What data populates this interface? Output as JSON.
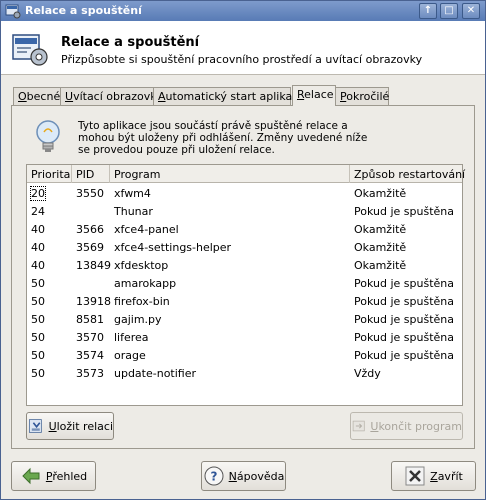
{
  "window": {
    "title": "Relace a spouštění"
  },
  "header": {
    "title": "Relace a spouštění",
    "subtitle": "Přizpůsobte si spouštění pracovního prostředí a uvítací obrazovky"
  },
  "tabs": [
    {
      "label": "Obecné",
      "accel": "O",
      "rest": "becné"
    },
    {
      "label": "Uvítací obrazovka",
      "accel": "U",
      "rest": "vítací obrazovka"
    },
    {
      "label": "Automatický start aplikace",
      "accel": "A",
      "rest": "utomatický start aplikace"
    },
    {
      "label": "Relace",
      "accel": "R",
      "rest": "elace",
      "active": true
    },
    {
      "label": "Pokročilé",
      "accel": "P",
      "rest": "okročilé"
    }
  ],
  "info": {
    "text": "Tyto aplikace jsou součástí právě spuštěné relace a mohou být uloženy při odhlášení. Změny uvedené níže se provedou pouze při uložení relace."
  },
  "table": {
    "columns": [
      "Priorita",
      "PID",
      "Program",
      "Způsob restartování"
    ],
    "rows": [
      {
        "priority": "20",
        "pid": "3550",
        "program": "xfwm4",
        "restart": "Okamžitě"
      },
      {
        "priority": "24",
        "pid": "",
        "program": "Thunar",
        "restart": "Pokud je spuštěna"
      },
      {
        "priority": "40",
        "pid": "3566",
        "program": "xfce4-panel",
        "restart": "Okamžitě"
      },
      {
        "priority": "40",
        "pid": "3569",
        "program": "xfce4-settings-helper",
        "restart": "Okamžitě"
      },
      {
        "priority": "40",
        "pid": "13849",
        "program": "xfdesktop",
        "restart": "Okamžitě"
      },
      {
        "priority": "50",
        "pid": "",
        "program": "amarokapp",
        "restart": "Pokud je spuštěna"
      },
      {
        "priority": "50",
        "pid": "13918",
        "program": "firefox-bin",
        "restart": "Pokud je spuštěna"
      },
      {
        "priority": "50",
        "pid": "8581",
        "program": "gajim.py",
        "restart": "Pokud je spuštěna"
      },
      {
        "priority": "50",
        "pid": "3570",
        "program": "liferea",
        "restart": "Pokud je spuštěna"
      },
      {
        "priority": "50",
        "pid": "3574",
        "program": "orage",
        "restart": "Pokud je spuštěna"
      },
      {
        "priority": "50",
        "pid": "3573",
        "program": "update-notifier",
        "restart": "Vždy"
      }
    ]
  },
  "buttons": {
    "save_session": {
      "accel": "U",
      "rest": "ložit relaci"
    },
    "kill_program": {
      "accel": "U",
      "rest": "končit program"
    },
    "overview": {
      "accel": "P",
      "rest": "řehled"
    },
    "help": {
      "accel": "N",
      "rest": "ápověda"
    },
    "close": {
      "accel": "Z",
      "rest": "avřít"
    }
  }
}
